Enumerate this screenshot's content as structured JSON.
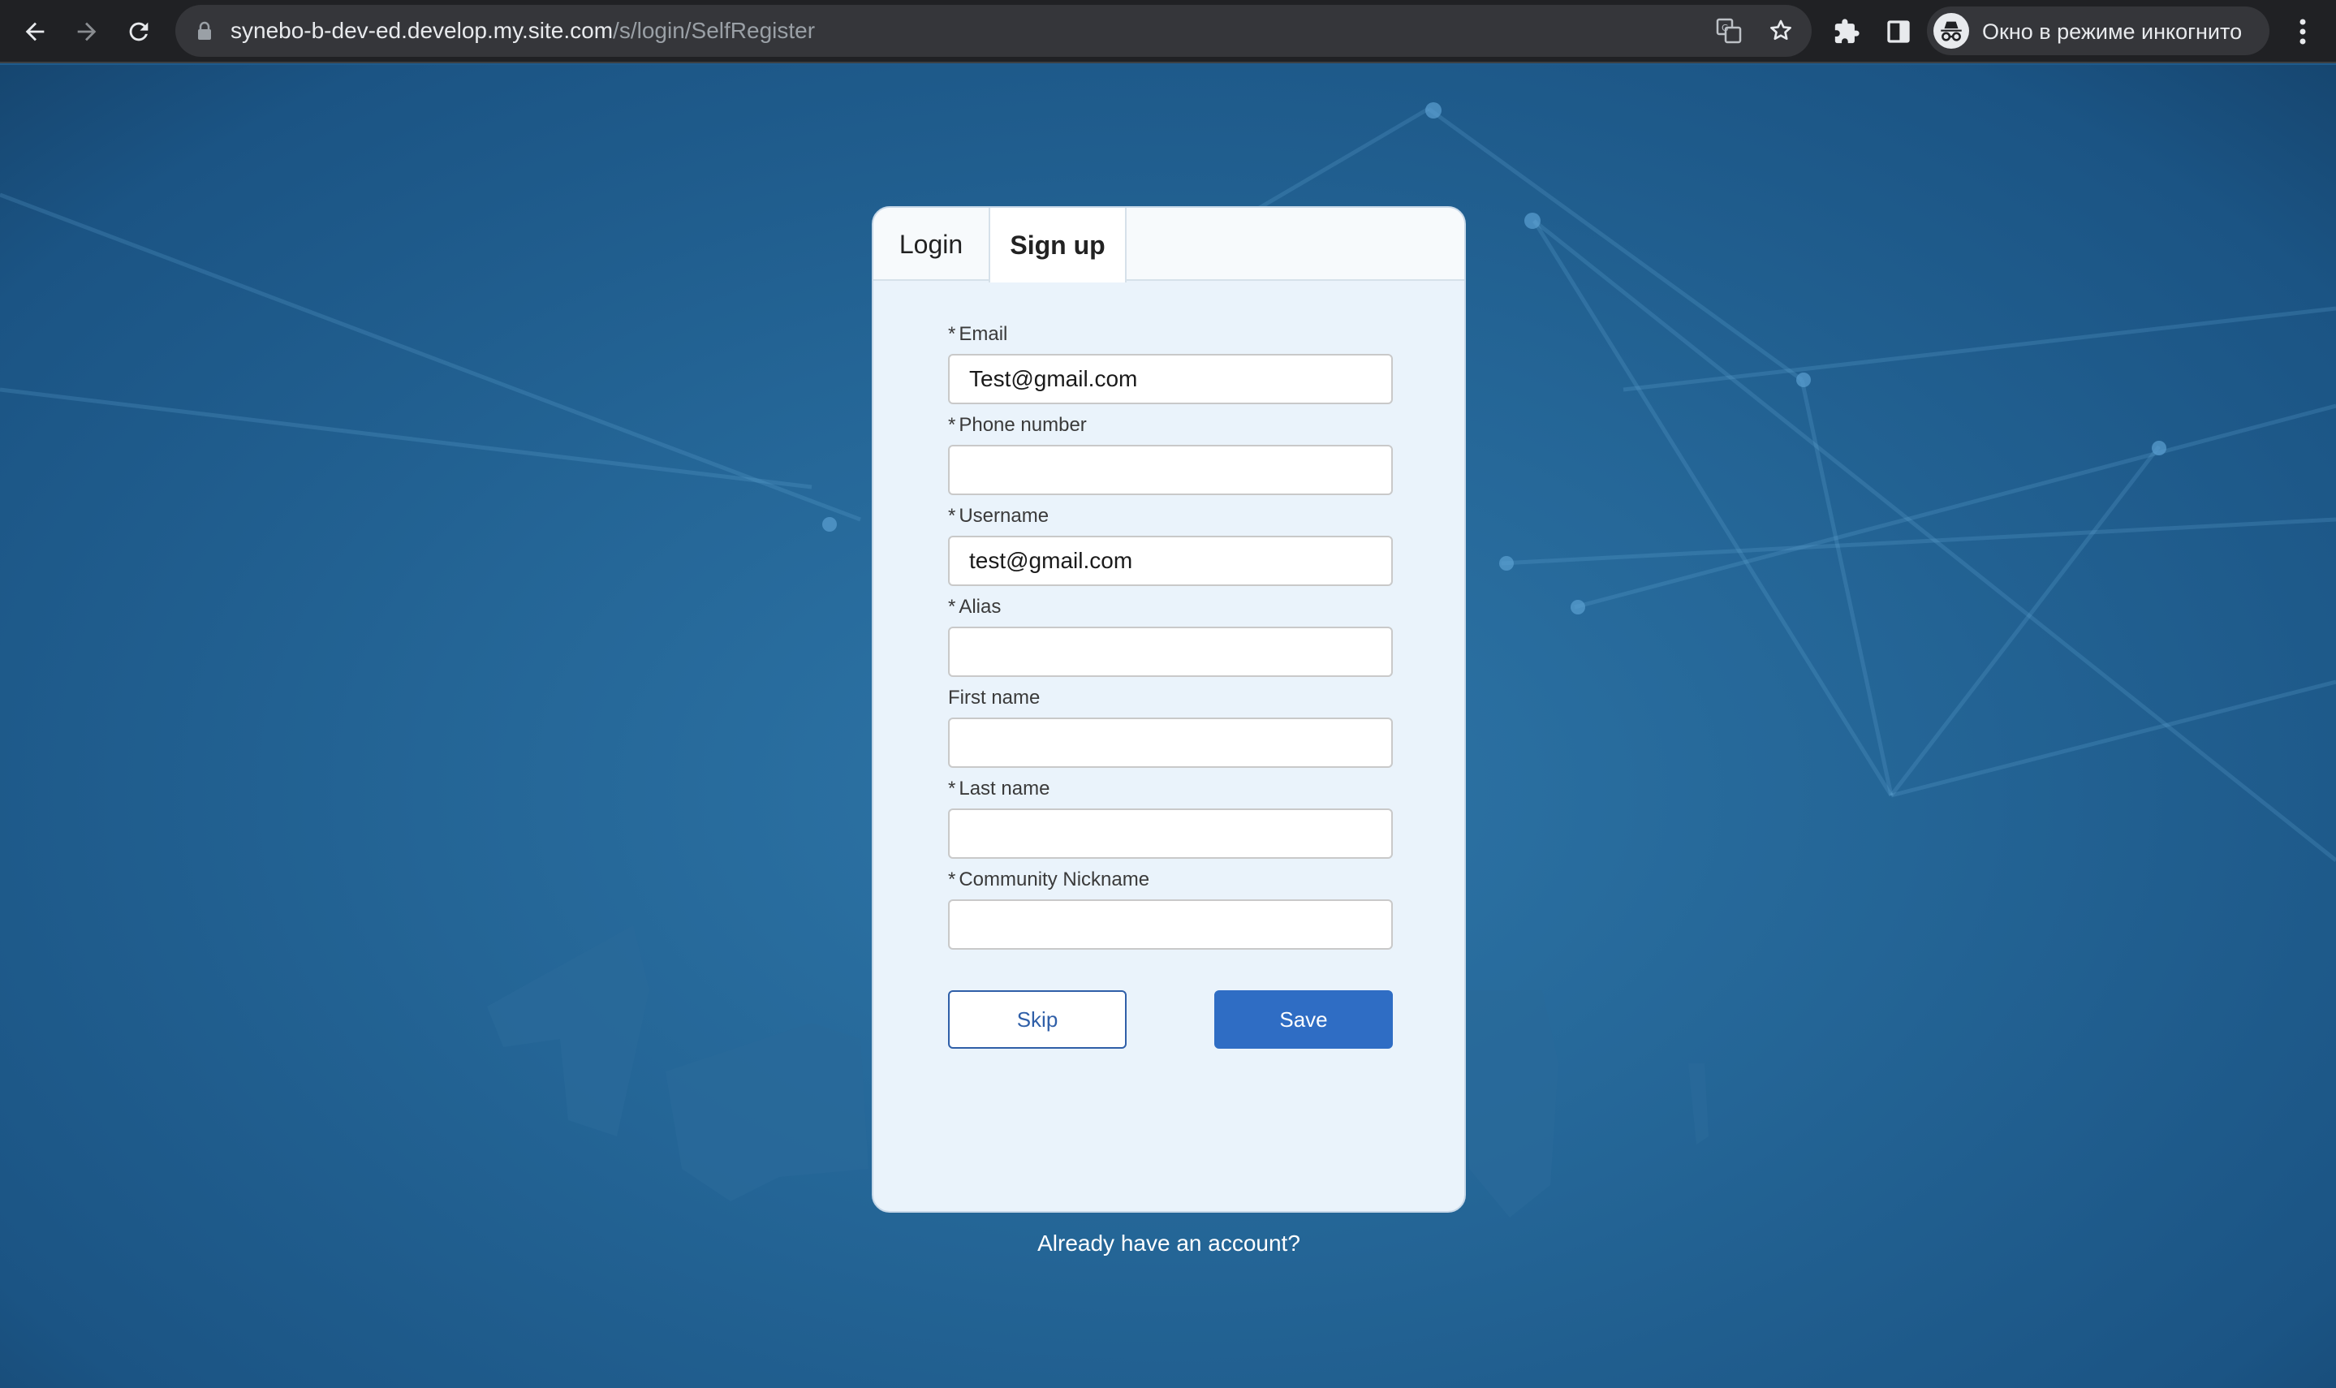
{
  "browser": {
    "url_host": "synebo-b-dev-ed.develop.my.site.com",
    "url_path": "/s/login/SelfRegister",
    "incognito_label": "Окно в режиме инкогнито",
    "icons": [
      "back-icon",
      "forward-icon",
      "reload-icon",
      "lock-icon",
      "translate-icon",
      "star-icon",
      "extensions-icon",
      "side-panel-icon",
      "incognito-icon",
      "more-menu-icon"
    ]
  },
  "tabs": {
    "login": "Login",
    "signup": "Sign up",
    "active": "signup"
  },
  "form": {
    "email": {
      "label": "Email",
      "required": "*",
      "value": "Test@gmail.com"
    },
    "phone": {
      "label": "Phone number",
      "required": "*",
      "value": ""
    },
    "username": {
      "label": "Username",
      "required": "*",
      "value": "test@gmail.com"
    },
    "alias": {
      "label": "Alias",
      "required": "*",
      "value": ""
    },
    "first_name": {
      "label": "First name",
      "value": ""
    },
    "last_name": {
      "label": "Last name",
      "required": "*",
      "value": ""
    },
    "nickname": {
      "label": "Community Nickname",
      "required": "*",
      "value": ""
    }
  },
  "buttons": {
    "skip": "Skip",
    "save": "Save"
  },
  "footer": {
    "already_account": "Already have an account?"
  },
  "colors": {
    "background": "#1f5b8c",
    "primary_button": "#2f6dc4",
    "card": "#eaf3fb"
  }
}
